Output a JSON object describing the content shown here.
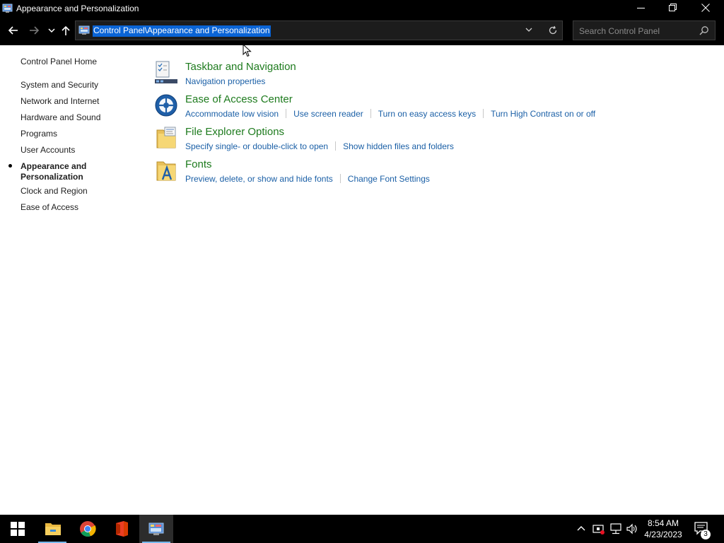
{
  "window": {
    "title": "Appearance and Personalization"
  },
  "address": {
    "path": "Control Panel\\Appearance and Personalization"
  },
  "search": {
    "placeholder": "Search Control Panel"
  },
  "leftnav": {
    "home": "Control Panel Home",
    "items": [
      {
        "label": "System and Security"
      },
      {
        "label": "Network and Internet"
      },
      {
        "label": "Hardware and Sound"
      },
      {
        "label": "Programs"
      },
      {
        "label": "User Accounts"
      },
      {
        "label": "Appearance and Personalization",
        "active": true
      },
      {
        "label": "Clock and Region"
      },
      {
        "label": "Ease of Access"
      }
    ]
  },
  "tasks": [
    {
      "title": "Taskbar and Navigation",
      "icon": "taskbar-icon",
      "links": [
        "Navigation properties"
      ]
    },
    {
      "title": "Ease of Access Center",
      "icon": "ease-of-access-icon",
      "links": [
        "Accommodate low vision",
        "Use screen reader",
        "Turn on easy access keys",
        "Turn High Contrast on or off"
      ]
    },
    {
      "title": "File Explorer Options",
      "icon": "folder-options-icon",
      "links": [
        "Specify single- or double-click to open",
        "Show hidden files and folders"
      ]
    },
    {
      "title": "Fonts",
      "icon": "fonts-icon",
      "links": [
        "Preview, delete, or show and hide fonts",
        "Change Font Settings"
      ]
    }
  ],
  "taskbar": {
    "time": "8:54 AM",
    "date": "4/23/2023",
    "notification_count": "3",
    "apps": [
      "start-icon",
      "file-explorer-icon",
      "chrome-icon",
      "office-icon",
      "control-panel-icon"
    ]
  },
  "colors": {
    "title_link": "#1e7b1e",
    "link": "#1a5fa6",
    "selection": "#0a64d6",
    "chrome": "#000000"
  }
}
